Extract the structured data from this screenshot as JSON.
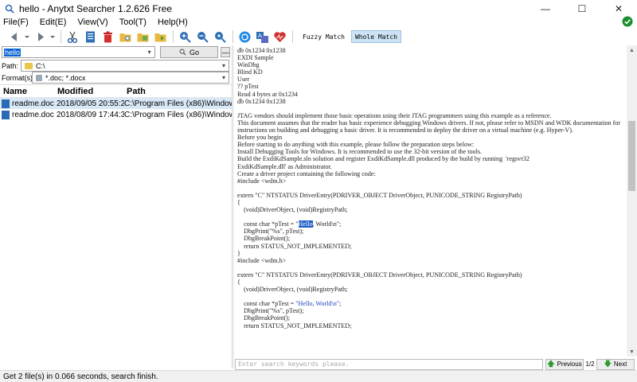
{
  "window": {
    "title": "hello - Anytxt Searcher 1.2.626 Free",
    "minimize_glyph": "—",
    "maximize_glyph": "☐",
    "close_glyph": "✕"
  },
  "menu": {
    "items": [
      "File(F)",
      "Edit(E)",
      "View(V)",
      "Tool(T)",
      "Help(H)"
    ]
  },
  "toolbar": {
    "icons": [
      "back-icon",
      "forward-icon",
      "scissors-icon",
      "document-icon",
      "trash-icon",
      "folder-search-icon",
      "folder-open-icon",
      "folder-export-icon",
      "zoom-in-icon",
      "zoom-out-icon",
      "zoom-reset-icon",
      "refresh-icon",
      "translate-icon",
      "heart-icon"
    ],
    "fuzzy_match": "Fuzzy Match",
    "whole_match": "Whole Match",
    "active_mode": "whole_match"
  },
  "search": {
    "keyword": "hello",
    "go_label": "Go",
    "minus_label": "—",
    "path_label": "Path:",
    "path_value": "C:\\",
    "format_label": "Format(s):",
    "format_value": "*.doc; *.docx"
  },
  "results": {
    "columns": [
      "Name",
      "Modified",
      "Path"
    ],
    "rows": [
      {
        "name": "readme.docx",
        "modified": "2018/09/05  20:55:28",
        "path": "C:\\Program Files (x86)\\Windows Kits"
      },
      {
        "name": "readme.docx",
        "modified": "2018/08/09  17:44:32",
        "path": "C:\\Program Files (x86)\\Windows Kits"
      }
    ],
    "selected_index": 0
  },
  "preview": {
    "lines_top": [
      "db 0x1234 0x1238",
      "EXDI Sample",
      "WinDbg",
      "Blind KD",
      "User",
      "?? pTest",
      "Read 4 bytes at 0x1234",
      "db 0x1234 0x1238",
      ""
    ],
    "paragraph_1": "JTAG vendors should implement those basic operations using their JTAG programmers using this example as a reference.",
    "paragraph_2": "This document assumes that the reader has basic experience debugging Windows drivers. If not, please refer to MSDN and WDK documentation for instructions on building and debugging a basic driver. It is recommended to deploy the driver on a virtual machine (e.g. Hyper-V).",
    "lines_mid": [
      "Before you begin",
      "Before starting to do anything with this example, please follow the preparation steps below:",
      "Install Debugging Tools for Windows. It is recommended to use the 32-bit version of the tools.",
      "Build the ExdiKdSample.sln solution and register ExdiKdSample.dll produced by the build by running  'regsvr32",
      "ExdiKdSample.dll' as Administrator.",
      "Create a driver project containing the following code:",
      "#include <wdm.h>"
    ],
    "code_1": {
      "entry": "extern \"C\" NTSTATUS DriverEntry(PDRIVER_OBJECT DriverObject, PUNICODE_STRING RegistryPath)",
      "open": "{",
      "void_line": "    (void)DriverObject, (void)RegistryPath;",
      "const_pre": "    const char *pTest = \"",
      "const_hit": "Hello",
      "const_post": ", World\\n\";",
      "printf": "    DbgPrint(\"%s\", pTest);",
      "brk": "    DbgBreakPoint();",
      "ret": "    return STATUS_NOT_IMPLEMENTED;",
      "close": "}"
    },
    "include_2": "#include <wdm.h>",
    "code_2": {
      "entry": "extern \"C\" NTSTATUS DriverEntry(PDRIVER_OBJECT DriverObject, PUNICODE_STRING RegistryPath)",
      "open": "{",
      "void_line": "    (void)DriverObject, (void)RegistryPath;",
      "const_pre": "    const char *pTest = ",
      "const_str": "\"Hello, World\\n\"",
      "const_post": ";",
      "printf": "    DbgPrint(\"%s\", pTest);",
      "brk": "    DbgBreakPoint();",
      "ret": "    return STATUS_NOT_IMPLEMENTED;"
    }
  },
  "find": {
    "placeholder": "Enter search keywords please.",
    "previous_label": "Previous",
    "page_indicator": "1/2",
    "next_label": "Next"
  },
  "status": {
    "text": "Get 2 file(s) in 0.066 seconds, search finish."
  },
  "colors": {
    "selection": "#0a64d2",
    "highlight": "#1f5fc7",
    "accent_green": "#2e9a2e"
  }
}
